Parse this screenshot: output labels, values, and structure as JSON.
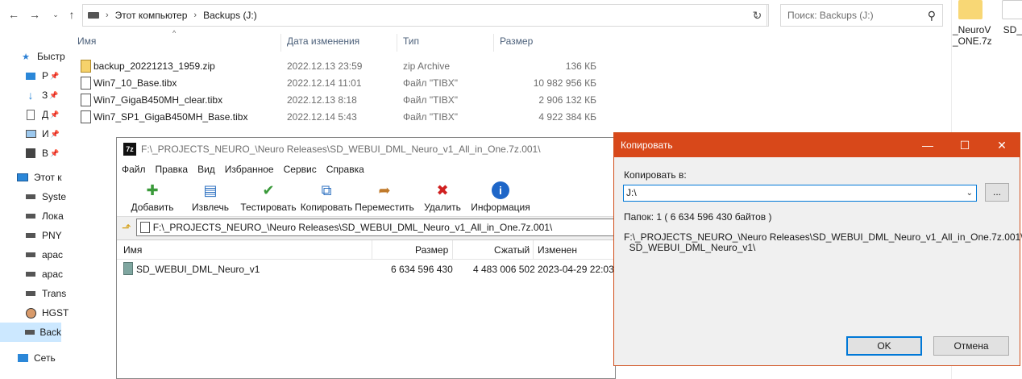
{
  "explorer": {
    "breadcrumb": [
      "Этот компьютер",
      "Backups (J:)"
    ],
    "search_placeholder": "Поиск: Backups (J:)",
    "columns": {
      "name": "Имя",
      "date": "Дата изменения",
      "type": "Тип",
      "size": "Размер"
    },
    "files": [
      {
        "name": "backup_20221213_1959.zip",
        "date": "2022.12.13 23:59",
        "type": "zip Archive",
        "size": "136 КБ",
        "icon": "zip-icon"
      },
      {
        "name": "Win7_10_Base.tibx",
        "date": "2022.12.14 11:01",
        "type": "Файл \"TIBX\"",
        "size": "10 982 956 КБ",
        "icon": "file-icon"
      },
      {
        "name": "Win7_GigaB450MH_clear.tibx",
        "date": "2022.12.13 8:18",
        "type": "Файл \"TIBX\"",
        "size": "2 906 132 КБ",
        "icon": "file-icon"
      },
      {
        "name": "Win7_SP1_GigaB450MH_Base.tibx",
        "date": "2022.12.14 5:43",
        "type": "Файл \"TIBX\"",
        "size": "4 922 384 КБ",
        "icon": "file-icon"
      }
    ],
    "sidebar": [
      {
        "label": "Быстр",
        "icon": "star-icon"
      },
      {
        "label": "Р",
        "icon": "desktop-icon"
      },
      {
        "label": "З",
        "icon": "download-icon"
      },
      {
        "label": "Д",
        "icon": "document-icon"
      },
      {
        "label": "И",
        "icon": "image-icon"
      },
      {
        "label": "В",
        "icon": "video-icon"
      },
      {
        "label": "Этот к",
        "icon": "computer-icon"
      },
      {
        "label": "Syste",
        "icon": "drive-icon"
      },
      {
        "label": "Лока",
        "icon": "drive-icon"
      },
      {
        "label": "PNY",
        "icon": "drive-icon"
      },
      {
        "label": "apac",
        "icon": "drive-icon"
      },
      {
        "label": "apac",
        "icon": "drive-icon"
      },
      {
        "label": "Trans",
        "icon": "drive-icon"
      },
      {
        "label": "HGST",
        "icon": "drive-icon"
      },
      {
        "label": "Back",
        "icon": "drive-icon"
      },
      {
        "label": "Сеть",
        "icon": "network-icon"
      }
    ],
    "right_items": [
      {
        "label_line1": "_NeuroV",
        "label_line2": "_ONE.7z"
      },
      {
        "label_line1": "SD_\\",
        "label_line2": ""
      }
    ]
  },
  "sevenzip": {
    "title": "F:\\_PROJECTS_NEURO_\\Neuro Releases\\SD_WEBUI_DML_Neuro_v1_All_in_One.7z.001\\",
    "menu": [
      "Файл",
      "Правка",
      "Вид",
      "Избранное",
      "Сервис",
      "Справка"
    ],
    "toolbar": [
      {
        "label": "Добавить",
        "icon": "add-icon"
      },
      {
        "label": "Извлечь",
        "icon": "extract-icon"
      },
      {
        "label": "Тестировать",
        "icon": "test-icon"
      },
      {
        "label": "Копировать",
        "icon": "copy-icon"
      },
      {
        "label": "Переместить",
        "icon": "move-icon"
      },
      {
        "label": "Удалить",
        "icon": "delete-icon"
      },
      {
        "label": "Информация",
        "icon": "info-icon"
      }
    ],
    "path": "F:\\_PROJECTS_NEURO_\\Neuro Releases\\SD_WEBUI_DML_Neuro_v1_All_in_One.7z.001\\",
    "columns": {
      "name": "Имя",
      "size": "Размер",
      "packed": "Сжатый",
      "modified": "Изменен"
    },
    "rows": [
      {
        "name": "SD_WEBUI_DML_Neuro_v1",
        "size": "6 634 596 430",
        "packed": "4 483 006 502",
        "modified": "2023-04-29 22:03"
      }
    ]
  },
  "dialog": {
    "title": "Копировать",
    "copy_to_label": "Копировать в:",
    "destination": "J:\\",
    "browse_label": "...",
    "info": "Папок: 1    ( 6 634 596 430 байтов )",
    "source_line1": "F:\\_PROJECTS_NEURO_\\Neuro Releases\\SD_WEBUI_DML_Neuro_v1_All_in_One.7z.001\\",
    "source_line2": "  SD_WEBUI_DML_Neuro_v1\\",
    "ok_label": "OK",
    "cancel_label": "Отмена",
    "accent_color": "#d8481a"
  }
}
